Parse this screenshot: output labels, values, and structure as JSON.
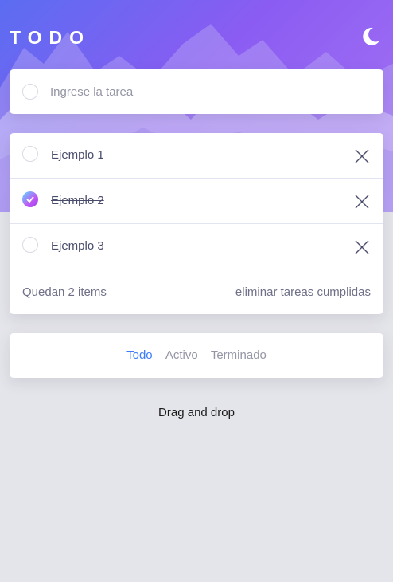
{
  "header": {
    "title": "TODO",
    "theme_icon": "moon-icon"
  },
  "new_todo": {
    "placeholder": "Ingrese la tarea",
    "value": ""
  },
  "todos": [
    {
      "label": "Ejemplo 1",
      "completed": false
    },
    {
      "label": "Ejemplo 2",
      "completed": true
    },
    {
      "label": "Ejemplo 3",
      "completed": false
    }
  ],
  "footer": {
    "items_left": "Quedan 2 items",
    "clear_label": "eliminar tareas cumplidas"
  },
  "filters": {
    "all": "Todo",
    "active": "Activo",
    "completed": "Terminado",
    "selected": "all"
  },
  "hint": "Drag and drop",
  "colors": {
    "accent": "#3a7cfd",
    "check_gradient_start": "#57ddff",
    "check_gradient_end": "#c058f3",
    "background": "#e4e5ea"
  }
}
